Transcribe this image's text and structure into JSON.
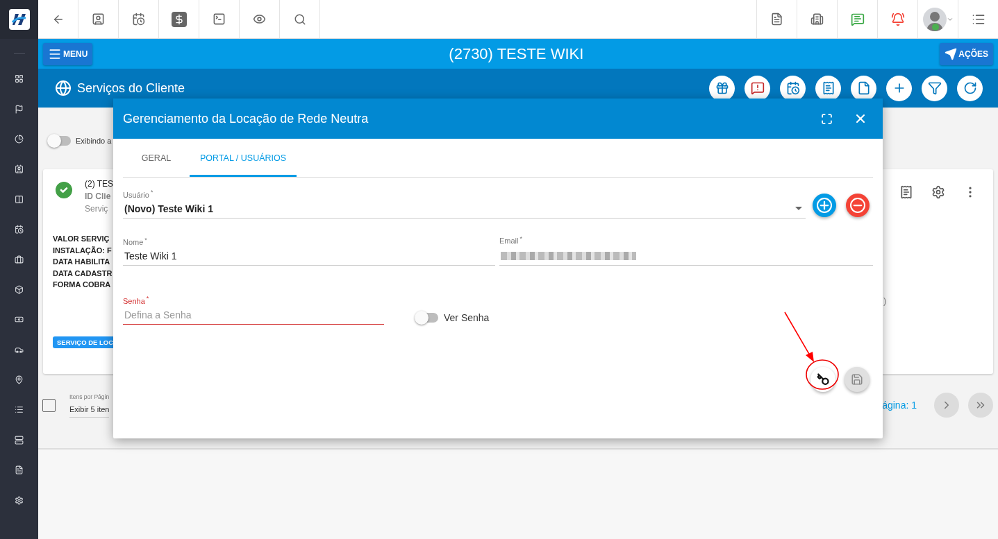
{
  "header": {
    "menu_button": "MENU",
    "title": "(2730) TESTE WIKI",
    "actions_button": "AÇÕES"
  },
  "subheader": {
    "title": "Serviços do Cliente"
  },
  "background": {
    "filter_toggle": {
      "label": "Exibindo a",
      "on": false
    },
    "card": {
      "title": "(2) TES",
      "id_line": "ID Clie",
      "service_line": "Serviç",
      "details": [
        "VALOR SERVIÇ",
        "INSTALAÇÃO: F",
        "DATA HABILITA",
        "DATA CADASTR",
        "FORMA COBRA"
      ],
      "badge": "SERVIÇO DE LOC",
      "fragment": ")"
    },
    "pagination": {
      "select_all": {
        "checked": false
      },
      "items_label": "Itens por Págin",
      "items_value": "Exibir 5 iten",
      "page": "ágina: 1"
    }
  },
  "modal": {
    "title": "Gerenciamento da Locação de Rede Neutra",
    "tabs": [
      {
        "label": "GERAL",
        "selected": false
      },
      {
        "label": "PORTAL / USUÁRIOS",
        "selected": true
      }
    ],
    "user_field": {
      "label": "Usuário$^{*}$",
      "value": "(Novo) Teste Wiki 1"
    },
    "name_field": {
      "label": "Nome$^{*}$",
      "value": "Teste Wiki 1"
    },
    "email_field": {
      "label": "Email$^{*}$"
    },
    "password_field": {
      "label": "Senha$^{*}$",
      "placeholder": "Defina a Senha",
      "invalid": true
    },
    "show_password": {
      "label": "Ver Senha",
      "on": false
    },
    "save_button": {
      "disabled": true
    }
  }
}
